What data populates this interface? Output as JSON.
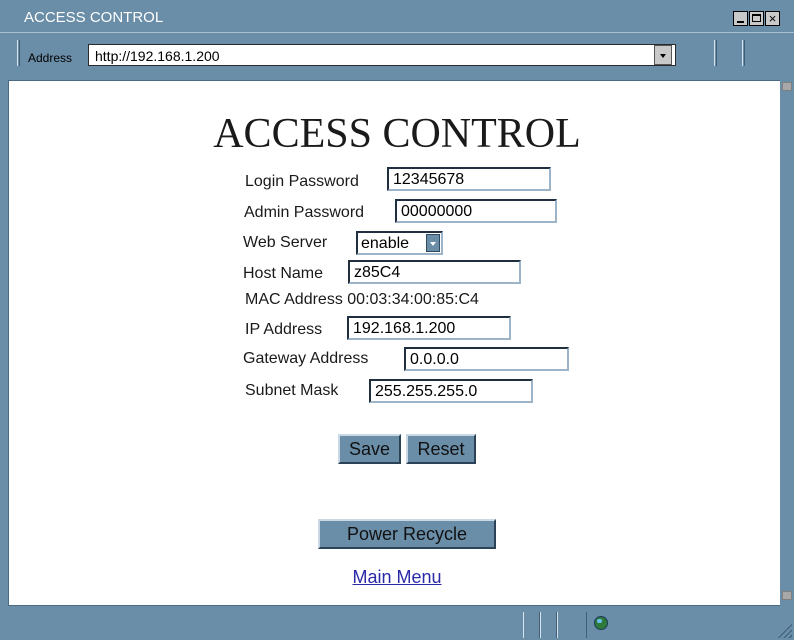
{
  "window": {
    "title": "ACCESS CONTROL"
  },
  "address_bar": {
    "label": "Address",
    "url": "http://192.168.1.200"
  },
  "page": {
    "heading": "ACCESS CONTROL",
    "fields": {
      "login_password": {
        "label": "Login Password",
        "value": "12345678"
      },
      "admin_password": {
        "label": "Admin Password",
        "value": "00000000"
      },
      "web_server": {
        "label": "Web Server",
        "value": "enable"
      },
      "host_name": {
        "label": "Host Name",
        "value": "z85C4"
      },
      "mac_address": {
        "label": "MAC Address",
        "value": "00:03:34:00:85:C4"
      },
      "ip_address": {
        "label": "IP Address",
        "value": "192.168.1.200"
      },
      "gateway_address": {
        "label": "Gateway Address",
        "value": "0.0.0.0"
      },
      "subnet_mask": {
        "label": "Subnet Mask",
        "value": "255.255.255.0"
      }
    },
    "buttons": {
      "save": "Save",
      "reset": "Reset",
      "power_recycle": "Power Recycle"
    },
    "links": {
      "main_menu": "Main Menu"
    }
  },
  "icons": {
    "status_zone": "globe-icon"
  }
}
